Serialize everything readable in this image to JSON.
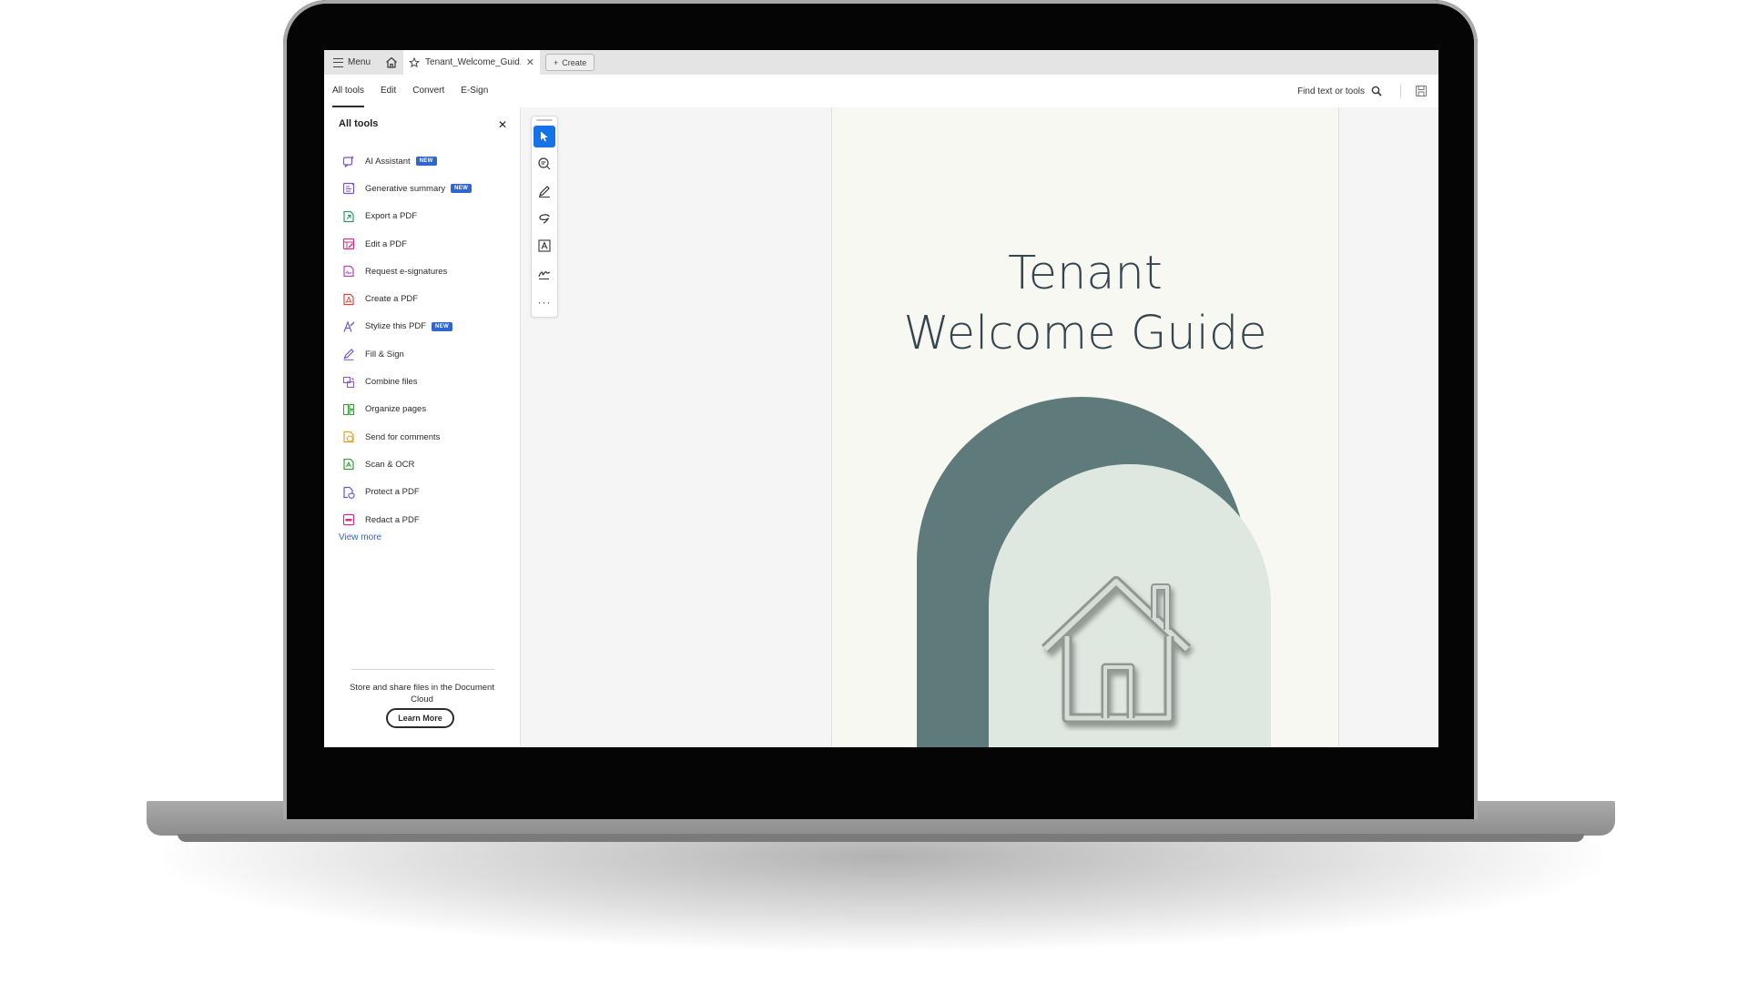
{
  "tabbar": {
    "menu_label": "Menu",
    "doc_tab_title": "Tenant_Welcome_Guid...",
    "create_label": "Create"
  },
  "menubar": {
    "tabs": [
      "All tools",
      "Edit",
      "Convert",
      "E-Sign"
    ],
    "active_tab": "All tools",
    "find_label": "Find text or tools"
  },
  "panel": {
    "title": "All tools",
    "tools": [
      {
        "label": "AI Assistant",
        "badge": "NEW",
        "icon": "ai-assistant-icon",
        "color": "#7b4fd6"
      },
      {
        "label": "Generative summary",
        "badge": "NEW",
        "icon": "generative-summary-icon",
        "color": "#7b4fd6"
      },
      {
        "label": "Export a PDF",
        "badge": "",
        "icon": "export-pdf-icon",
        "color": "#2e9b6a"
      },
      {
        "label": "Edit a PDF",
        "badge": "",
        "icon": "edit-pdf-icon",
        "color": "#d4317d"
      },
      {
        "label": "Request e-signatures",
        "badge": "",
        "icon": "request-esignatures-icon",
        "color": "#b344c8"
      },
      {
        "label": "Create a PDF",
        "badge": "",
        "icon": "create-pdf-icon",
        "color": "#e0453a"
      },
      {
        "label": "Stylize this PDF",
        "badge": "NEW",
        "icon": "stylize-pdf-icon",
        "color": "#6a5ad6"
      },
      {
        "label": "Fill & Sign",
        "badge": "",
        "icon": "fill-sign-icon",
        "color": "#7456d0"
      },
      {
        "label": "Combine files",
        "badge": "",
        "icon": "combine-files-icon",
        "color": "#8e59d9"
      },
      {
        "label": "Organize pages",
        "badge": "",
        "icon": "organize-pages-icon",
        "color": "#3a9e3e"
      },
      {
        "label": "Send for comments",
        "badge": "",
        "icon": "send-comments-icon",
        "color": "#e0a42a"
      },
      {
        "label": "Scan & OCR",
        "badge": "",
        "icon": "scan-ocr-icon",
        "color": "#3a9e3e"
      },
      {
        "label": "Protect a PDF",
        "badge": "",
        "icon": "protect-pdf-icon",
        "color": "#6556d8"
      },
      {
        "label": "Redact a PDF",
        "badge": "",
        "icon": "redact-pdf-icon",
        "color": "#d4317d"
      }
    ],
    "view_more": "View more",
    "promo_text": "Store and share files in the Document Cloud",
    "learn_more": "Learn More"
  },
  "document": {
    "title_line1": "Tenant",
    "title_line2": "Welcome Guide",
    "colors": {
      "arch_dark": "#5e7a7b",
      "arch_light": "#dfe8e0",
      "title": "#34454f"
    }
  },
  "quick_tools": [
    "select-cursor-icon",
    "add-comment-icon",
    "highlight-pen-icon",
    "draw-icon",
    "text-box-icon",
    "fill-sign-tool-icon",
    "more-tools-icon"
  ],
  "accent_color": "#1473e6"
}
